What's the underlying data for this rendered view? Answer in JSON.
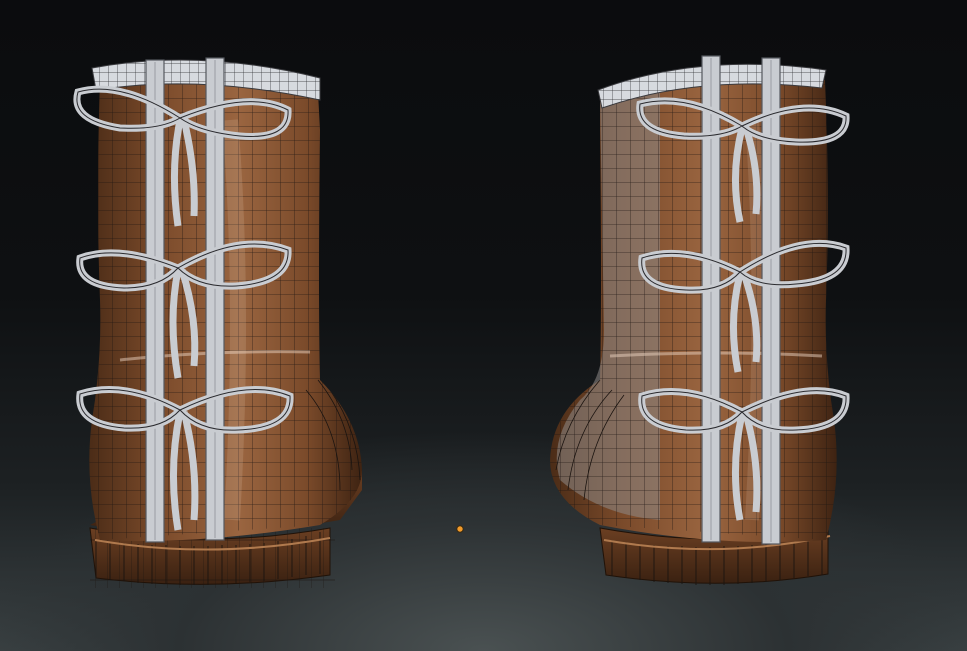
{
  "viewport": {
    "object_name": "boots-wireframe-render",
    "origin_marker_color": "#f29b2b",
    "colors": {
      "leather": "#7a4a2a",
      "leather_dark": "#4b2c17",
      "leather_light": "#9a6540",
      "strap": "#c9ccd1",
      "wire": "#1b1410",
      "collar": "#d7dadf"
    }
  },
  "boots": [
    {
      "id": "left",
      "bows": 3
    },
    {
      "id": "right",
      "bows": 3
    }
  ]
}
